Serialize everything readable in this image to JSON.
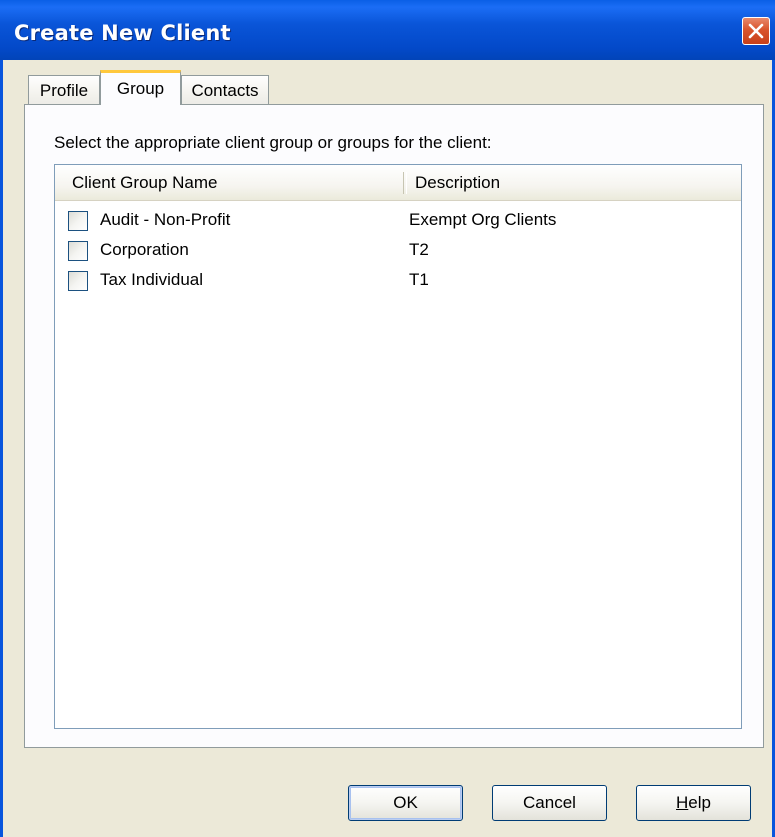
{
  "window": {
    "title": "Create New Client"
  },
  "tabs": [
    {
      "label": "Profile",
      "active": false
    },
    {
      "label": "Group",
      "active": true
    },
    {
      "label": "Contacts",
      "active": false
    }
  ],
  "group_tab": {
    "instruction": "Select the appropriate client group or groups for the client:",
    "columns": [
      "Client Group Name",
      "Description"
    ],
    "rows": [
      {
        "name": "Audit - Non-Profit",
        "description": "Exempt Org Clients",
        "checked": false
      },
      {
        "name": "Corporation",
        "description": "T2",
        "checked": false
      },
      {
        "name": "Tax Individual",
        "description": "T1",
        "checked": false
      }
    ]
  },
  "buttons": {
    "ok": "OK",
    "cancel": "Cancel",
    "help_mnemonic": "H",
    "help_rest": "elp"
  },
  "icons": {
    "close": "close-icon"
  },
  "colors": {
    "titlebar": "#0a55d8",
    "close": "#d9542c",
    "active_tab_accent": "#ffc83c"
  }
}
